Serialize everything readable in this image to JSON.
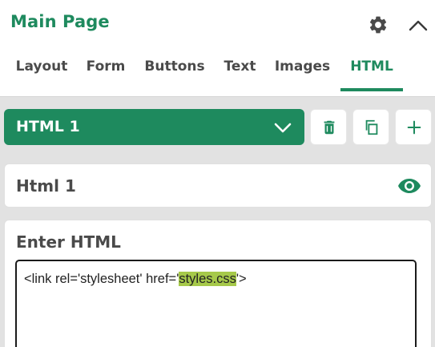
{
  "header": {
    "title": "Main Page",
    "settings_icon": "gear-icon",
    "collapse_icon": "chevron-up-icon"
  },
  "tabs": [
    {
      "label": "Layout",
      "active": false
    },
    {
      "label": "Form",
      "active": false
    },
    {
      "label": "Buttons",
      "active": false
    },
    {
      "label": "Text",
      "active": false
    },
    {
      "label": "Images",
      "active": false
    },
    {
      "label": "HTML",
      "active": true
    }
  ],
  "selector": {
    "value": "HTML 1",
    "dropdown_icon": "chevron-down-icon",
    "actions": [
      {
        "name": "delete",
        "icon": "trash-icon"
      },
      {
        "name": "duplicate",
        "icon": "copy-icon"
      },
      {
        "name": "add",
        "icon": "plus-icon"
      }
    ]
  },
  "element": {
    "name": "Html 1",
    "visibility_icon": "eye-icon"
  },
  "html_editor": {
    "label": "Enter HTML",
    "code_before": "<link rel='stylesheet' href='",
    "code_highlight": "styles.css",
    "code_after": "'>"
  },
  "colors": {
    "accent": "#1e8a5e",
    "background": "#e2e2e2",
    "highlight": "#a6c94a"
  }
}
